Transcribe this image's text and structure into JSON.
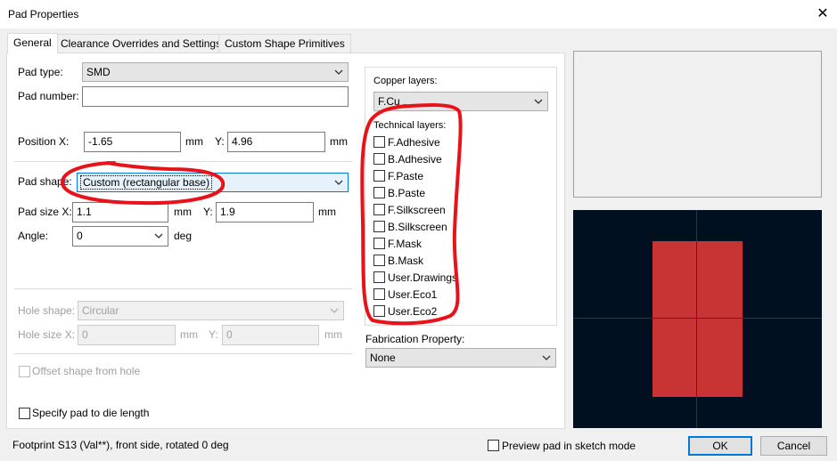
{
  "window": {
    "title": "Pad Properties"
  },
  "tabs": [
    {
      "label": "General"
    },
    {
      "label": "Clearance Overrides and Settings"
    },
    {
      "label": "Custom Shape Primitives"
    }
  ],
  "general": {
    "pad_type_label": "Pad type:",
    "pad_type_value": "SMD",
    "pad_number_label": "Pad number:",
    "pad_number_value": "",
    "position_x_label": "Position X:",
    "position_x_value": "-1.65",
    "position_x_unit": "mm",
    "position_y_label": "Y:",
    "position_y_value": "4.96",
    "position_y_unit": "mm",
    "pad_shape_label": "Pad shape:",
    "pad_shape_value": "Custom (rectangular base)",
    "pad_size_x_label": "Pad size X:",
    "pad_size_x_value": "1.1",
    "pad_size_x_unit": "mm",
    "pad_size_y_label": "Y:",
    "pad_size_y_value": "1.9",
    "pad_size_y_unit": "mm",
    "angle_label": "Angle:",
    "angle_value": "0",
    "angle_unit": "deg",
    "hole_shape_label": "Hole shape:",
    "hole_shape_value": "Circular",
    "hole_size_x_label": "Hole size X:",
    "hole_size_x_value": "0",
    "hole_size_x_unit": "mm",
    "hole_size_y_label": "Y:",
    "hole_size_y_value": "0",
    "hole_size_y_unit": "mm",
    "offset_label": "Offset shape from hole",
    "die_length_label": "Specify pad to die length"
  },
  "layers": {
    "copper_label": "Copper layers:",
    "copper_value": "F.Cu",
    "technical_label": "Technical layers:",
    "technical": [
      "F.Adhesive",
      "B.Adhesive",
      "F.Paste",
      "B.Paste",
      "F.Silkscreen",
      "B.Silkscreen",
      "F.Mask",
      "B.Mask",
      "User.Drawings",
      "User.Eco1",
      "User.Eco2"
    ],
    "fabrication_label": "Fabrication Property:",
    "fabrication_value": "None"
  },
  "footer": {
    "status": "Footprint S13 (Val**), front side, rotated 0 deg",
    "preview_sketch_label": "Preview pad in sketch mode",
    "ok_label": "OK",
    "cancel_label": "Cancel"
  },
  "colors": {
    "preview_bg": "#001020",
    "pad_fill": "#c83434",
    "crosshair": "#1a1aff",
    "annotation": "#e8131a",
    "focus_accent": "#0078d7"
  }
}
